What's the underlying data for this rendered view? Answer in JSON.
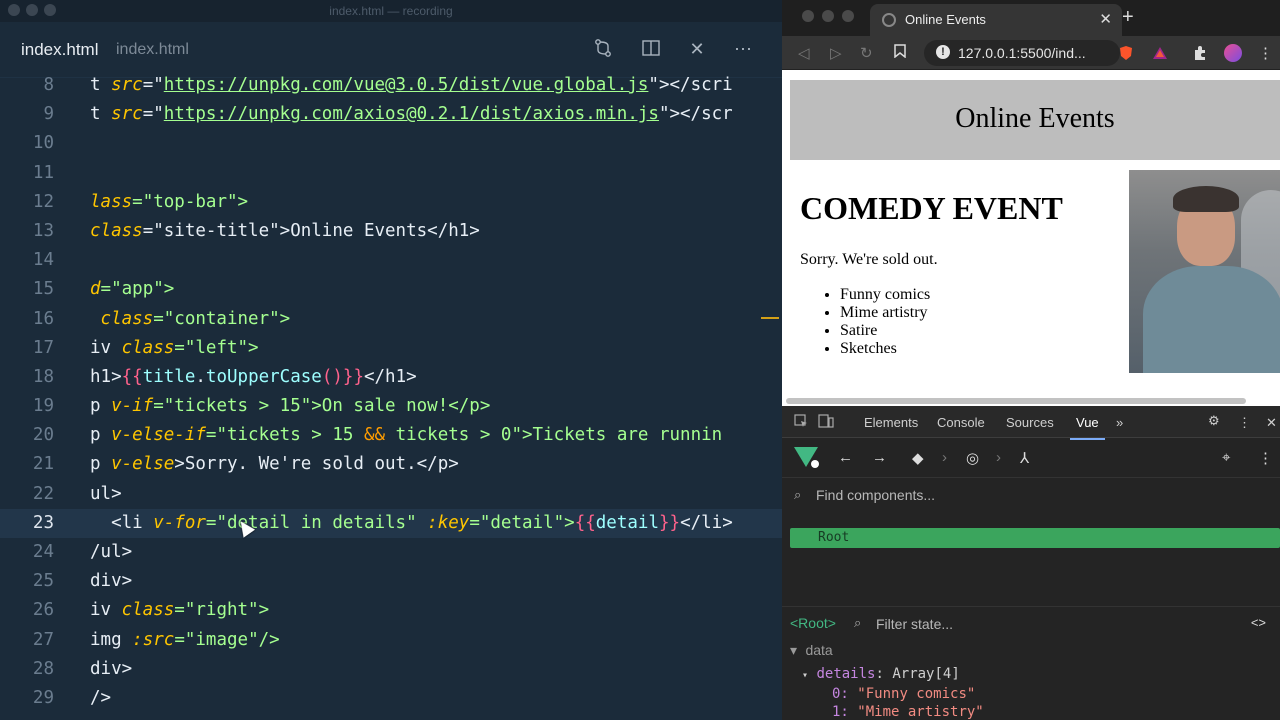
{
  "editor": {
    "window_title": "index.html — recording",
    "tab_filename": "index.html",
    "tab_path": "index.html",
    "lines": [
      {
        "num": "8"
      },
      {
        "num": "9"
      },
      {
        "num": "10"
      },
      {
        "num": "11"
      },
      {
        "num": "12"
      },
      {
        "num": "13"
      },
      {
        "num": "14"
      },
      {
        "num": "15"
      },
      {
        "num": "16"
      },
      {
        "num": "17"
      },
      {
        "num": "18"
      },
      {
        "num": "19"
      },
      {
        "num": "20"
      },
      {
        "num": "21"
      },
      {
        "num": "22"
      },
      {
        "num": "23"
      },
      {
        "num": "24"
      },
      {
        "num": "25"
      },
      {
        "num": "26"
      },
      {
        "num": "27"
      },
      {
        "num": "28"
      },
      {
        "num": "29"
      }
    ],
    "code": {
      "l8_pre": "t ",
      "l8_attr": "src",
      "l8_eq": "=\"",
      "l8_url": "https://unpkg.com/vue@3.0.5/dist/vue.global.js",
      "l8_post": "\"></scri",
      "l9_pre": "t ",
      "l9_attr": "src",
      "l9_eq": "=\"",
      "l9_url": "https://unpkg.com/axios@0.2.1/dist/axios.min.js",
      "l9_post": "\"></scr",
      "l12_a": "lass",
      "l12_b": "=\"top-bar\">",
      "l13_a": "class",
      "l13_b": "=\"site-title\">Online Events</h1>",
      "l15_a": "d",
      "l15_b": "=\"app\">",
      "l16_a": " class",
      "l16_b": "=\"container\">",
      "l17_a": "iv ",
      "l17_b": "class",
      "l17_c": "=\"left\">",
      "l18_a": "h1>",
      "l18_b": "{{",
      "l18_c": "title",
      "l18_d": ".",
      "l18_e": "toUpperCase",
      "l18_f": "()",
      "l18_g": "}}",
      "l18_h": "</h1>",
      "l19_a": "p ",
      "l19_b": "v-if",
      "l19_c": "=\"tickets > 15\">On sale now!</p>",
      "l20_a": "p ",
      "l20_b": "v-else-if",
      "l20_c": "=\"tickets > 15 ",
      "l20_d": "&&",
      "l20_e": " tickets > 0\">Tickets are runnin",
      "l21_a": "p ",
      "l21_b": "v-else",
      "l21_c": ">Sorry. We're sold out.</p>",
      "l22_a": "ul>",
      "l23_a": "  <li ",
      "l23_b": "v-for",
      "l23_c": "=\"detail in details\" ",
      "l23_d": ":key",
      "l23_e": "=\"detail\">",
      "l23_f": "{{",
      "l23_g": "detail",
      "l23_h": "}}",
      "l23_i": "</li>",
      "l24_a": "/ul>",
      "l25_a": "div>",
      "l26_a": "iv ",
      "l26_b": "class",
      "l26_c": "=\"right\">",
      "l27_a": "img ",
      "l27_b": ":src",
      "l27_c": "=\"image\"/>",
      "l28_a": "div>",
      "l29_a": "/>"
    }
  },
  "browser": {
    "tab_title": "Online Events",
    "url": "127.0.0.1:5500/ind...",
    "page": {
      "site_title": "Online Events",
      "event_title": "COMEDY EVENT",
      "status": "Sorry. We're sold out.",
      "details": [
        "Funny comics",
        "Mime artistry",
        "Satire",
        "Sketches"
      ]
    },
    "devtools": {
      "tabs": [
        "Elements",
        "Console",
        "Sources",
        "Vue"
      ],
      "active_tab": "Vue",
      "find_placeholder": "Find components...",
      "root_label": "Root",
      "selected_component": "<Root>",
      "filter_placeholder": "Filter state...",
      "data_label": "data",
      "details_key": "details",
      "details_type": "Array[4]",
      "item0_index": "0:",
      "item0_value": "\"Funny comics\"",
      "item1_index": "1:",
      "item1_value": "\"Mime artistry\""
    }
  }
}
